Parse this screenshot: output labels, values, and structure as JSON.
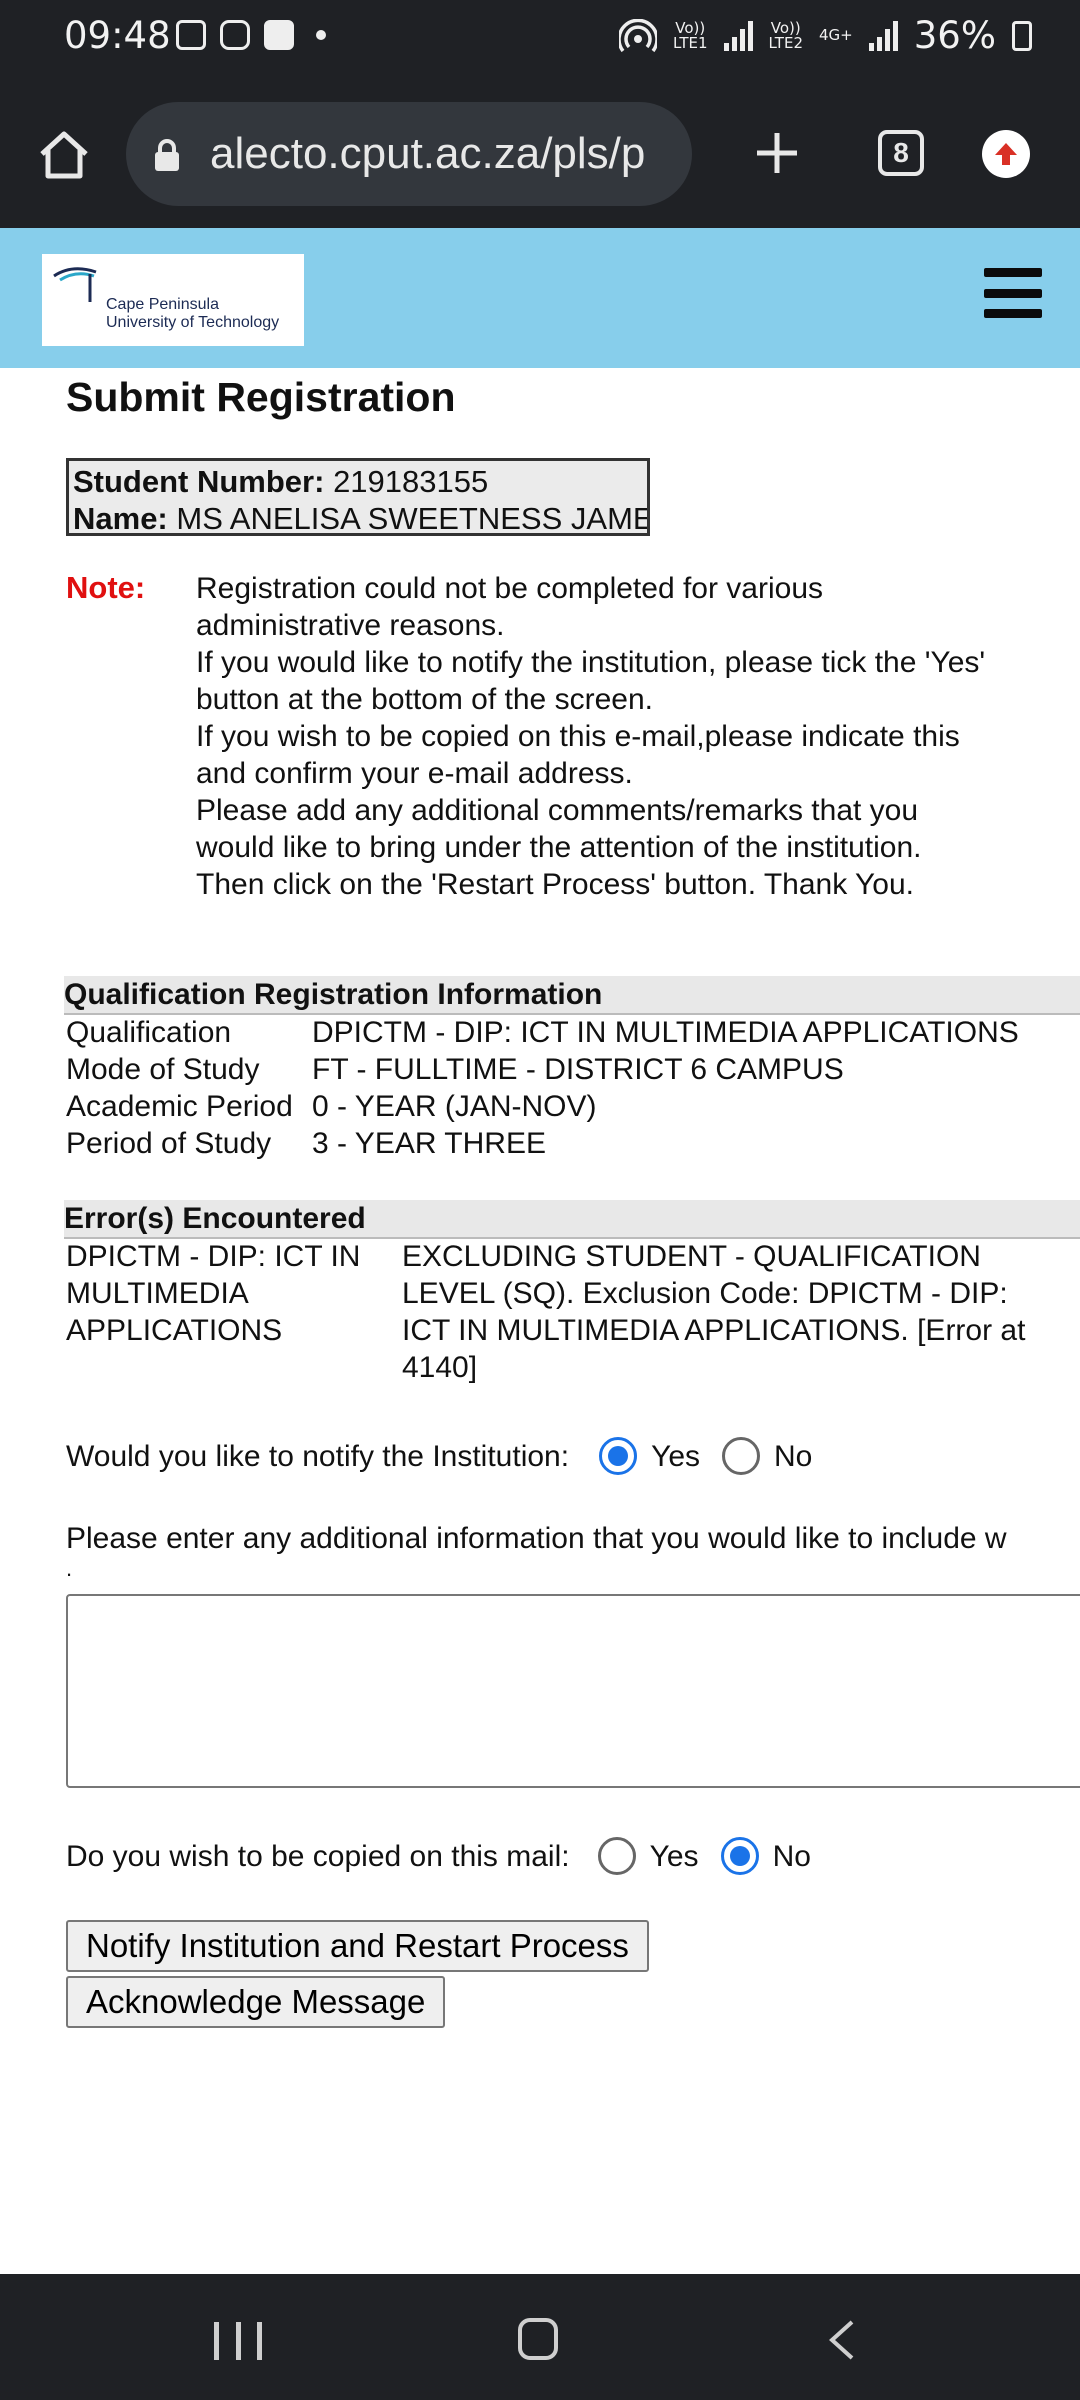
{
  "status_bar": {
    "time": "09:48",
    "icons_left": [
      "image-icon",
      "instagram-icon",
      "check-box-icon",
      "dot-icon"
    ],
    "hotspot_icon": "hotspot-icon",
    "sim1_label": "Vo))\nLTE1",
    "sim2_label": "Vo))\nLTE2",
    "network_type": "4G+",
    "battery_percent": "36%"
  },
  "browser": {
    "url": "alecto.cput.ac.za/pls/p",
    "tab_count": "8"
  },
  "header": {
    "logo_line1": "Cape Peninsula",
    "logo_line2": "University of Technology"
  },
  "page": {
    "title": "Submit Registration",
    "student_number_label": "Student Number:",
    "student_number": "219183155",
    "name_label": "Name:",
    "name": "MS ANELISA SWEETNESS JAMES",
    "note_label": "Note:",
    "note_lines": [
      "Registration could not be completed for various",
      "administrative reasons.",
      "If you would like to notify the institution, please tick the 'Yes'",
      "button at the bottom of the screen.",
      "If you wish to be copied on this e-mail,please indicate this",
      "and confirm your e-mail address.",
      "Please add any additional comments/remarks that you",
      "would like to bring under the attention of the institution.",
      "Then click on the 'Restart Process' button. Thank You."
    ]
  },
  "qualification": {
    "heading": "Qualification Registration Information",
    "rows": [
      {
        "key": "Qualification",
        "value": "DPICTM - DIP: ICT IN MULTIMEDIA APPLICATIONS"
      },
      {
        "key": "Mode of Study",
        "value": "FT - FULLTIME - DISTRICT 6 CAMPUS"
      },
      {
        "key": "Academic Period",
        "value": "0 - YEAR (JAN-NOV)"
      },
      {
        "key": "Period of Study",
        "value": "3 - YEAR THREE"
      }
    ]
  },
  "errors": {
    "heading": "Error(s) Encountered",
    "left_lines": [
      "DPICTM - DIP: ICT IN",
      "MULTIMEDIA",
      "APPLICATIONS"
    ],
    "right_lines": [
      "EXCLUDING STUDENT - QUALIFICATION",
      "LEVEL (SQ). Exclusion Code: DPICTM - DIP:",
      "ICT IN MULTIMEDIA APPLICATIONS. [Error at",
      "4140]"
    ]
  },
  "notify": {
    "question": "Would you like to notify the Institution:",
    "yes_label": "Yes",
    "no_label": "No",
    "selected": "Yes"
  },
  "additional": {
    "prompt": "Please enter any additional information that you would like to include w",
    "prompt_tail": ".",
    "value": ""
  },
  "copy": {
    "question": "Do you wish to be copied on this mail:",
    "yes_label": "Yes",
    "no_label": "No",
    "selected": "No"
  },
  "buttons": {
    "notify_restart": "Notify Institution and Restart Process",
    "acknowledge": "Acknowledge Message"
  },
  "colors": {
    "header_bg": "#87ceeb",
    "note_red": "#e01010",
    "radio_blue": "#1a73e8",
    "chrome_dark": "#1f2125"
  }
}
